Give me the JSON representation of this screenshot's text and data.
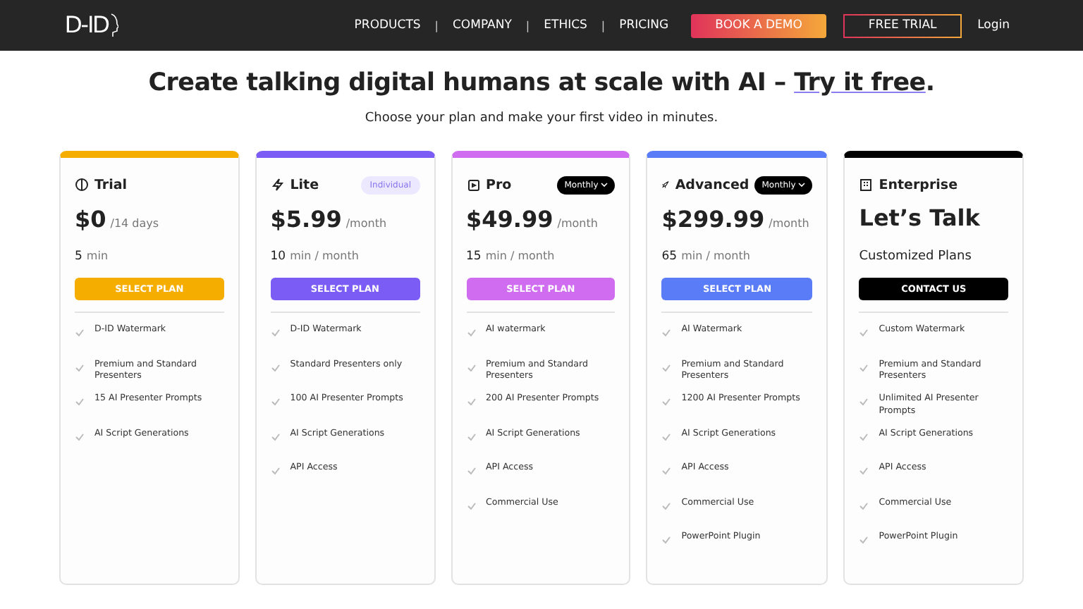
{
  "nav": {
    "logo": "D-ID",
    "links": [
      "PRODUCTS",
      "COMPANY",
      "ETHICS",
      "PRICING"
    ],
    "separator": "|",
    "demo_button": "BOOK A DEMO",
    "trial_button": "FREE TRIAL",
    "login": "Login"
  },
  "hero": {
    "title": "Create talking digital humans at scale with AI – ",
    "title_link": "Try it free",
    "title_end": ".",
    "subtitle": "Choose your plan and make your first video in minutes."
  },
  "plans": [
    {
      "kind": "priced",
      "name": "Trial",
      "color": "#f5ad00",
      "price": "$0",
      "period": "/14 days",
      "minutes": "5",
      "minutes_unit": "min",
      "button": "SELECT PLAN",
      "features": [
        "D-ID Watermark",
        "Premium and Standard Presenters",
        "15 AI Presenter Prompts",
        "AI Script Generations"
      ]
    },
    {
      "kind": "priced",
      "name": "Lite",
      "color": "#7b5cf5",
      "badge": {
        "kind": "tag",
        "text": "Individual"
      },
      "price": "$5.99",
      "period": "/month",
      "minutes": "10",
      "minutes_unit": "min / month",
      "button": "SELECT PLAN",
      "features": [
        "D-ID Watermark",
        "Standard Presenters only",
        "100 AI Presenter Prompts",
        "AI Script Generations",
        "API Access"
      ]
    },
    {
      "kind": "priced",
      "name": "Pro",
      "color": "#cf6cf0",
      "badge": {
        "kind": "dropdown",
        "text": "Monthly"
      },
      "price": "$49.99",
      "period": "/month",
      "minutes": "15",
      "minutes_unit": "min / month",
      "button": "SELECT PLAN",
      "features": [
        "AI watermark",
        "Premium and Standard Presenters",
        "200 AI Presenter Prompts",
        "AI Script Generations",
        "API Access",
        "Commercial Use"
      ]
    },
    {
      "kind": "priced",
      "name": "Advanced",
      "color": "#5b7cf7",
      "badge": {
        "kind": "dropdown",
        "text": "Monthly"
      },
      "price": "$299.99",
      "period": "/month",
      "minutes": "65",
      "minutes_unit": "min / month",
      "button": "SELECT PLAN",
      "features": [
        "AI Watermark",
        "Premium and Standard Presenters",
        "1200 AI Presenter Prompts",
        "AI Script Generations",
        "API Access",
        "Commercial Use",
        "PowerPoint Plugin"
      ]
    },
    {
      "kind": "custom",
      "name": "Enterprise",
      "color": "#000000",
      "headline": "Let’s Talk",
      "subline": "Customized Plans",
      "button": "CONTACT US",
      "features": [
        "Custom Watermark",
        "Premium and Standard Presenters",
        "Unlimited AI Presenter Prompts",
        "AI Script Generations",
        "API Access",
        "Commercial Use",
        "PowerPoint Plugin"
      ]
    }
  ]
}
